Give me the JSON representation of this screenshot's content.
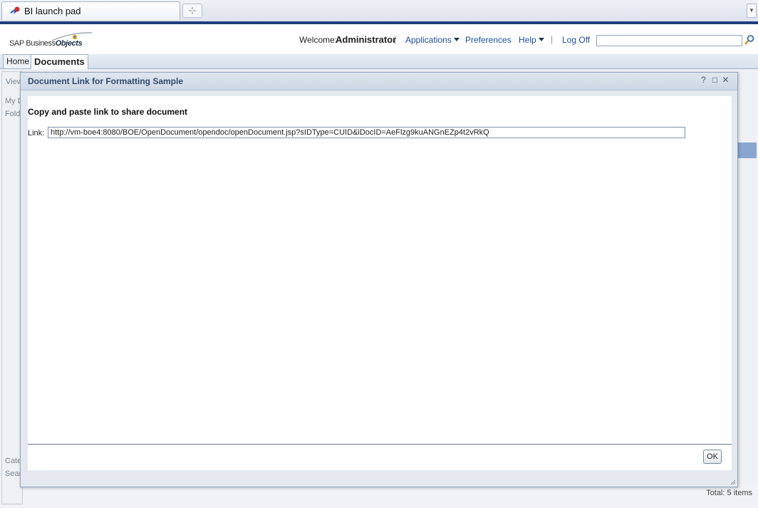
{
  "browser": {
    "tab_title": "BI launch pad",
    "new_tab_symbol": "⊹"
  },
  "header": {
    "logo_text_plain": "SAP Business",
    "logo_text_bold": "Objects",
    "welcome_label": "Welcome:",
    "user_name": "Administrator",
    "applications_label": "Applications",
    "preferences_label": "Preferences",
    "help_label": "Help",
    "logoff_label": "Log Off",
    "search_value": ""
  },
  "app_tabs": {
    "home_label": "Home",
    "documents_label": "Documents"
  },
  "background": {
    "ghost_view": "View",
    "ghost_my": "My D",
    "ghost_folders": "Fold",
    "ghost_categories": "Cate",
    "ghost_search": "Sear",
    "status_text": "Total: 5 items"
  },
  "dialog": {
    "title": "Document Link for Formatting Sample",
    "help_symbol": "?",
    "maximize_symbol": "□",
    "close_symbol": "✕",
    "heading": "Copy and paste link to share document",
    "link_label": "Link:",
    "link_value": "http://vm-boe4:8080/BOE/OpenDocument/opendoc/openDocument.jsp?sIDType=CUID&iDocID=AeFlzg9kuANGnEZp4t2vRkQ",
    "ok_label": "OK"
  },
  "colors": {
    "brand_blue": "#1e3e7a",
    "link_blue": "#1c4d99",
    "dialog_title_text": "#2f4a6e"
  }
}
